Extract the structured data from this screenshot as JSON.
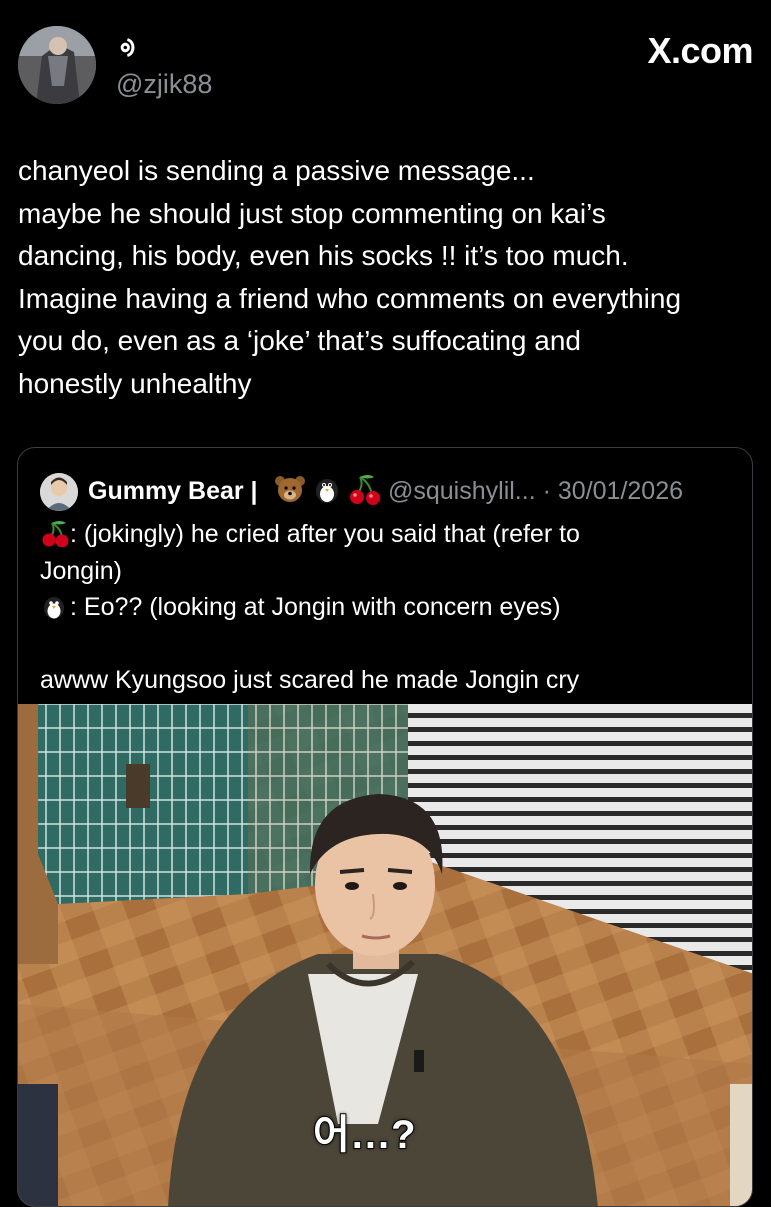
{
  "author": {
    "display_name": "ᢀ",
    "handle": "@zjik88"
  },
  "watermark": "X.com",
  "tweet_lines": [
    "chanyeol is sending a passive message...",
    "maybe he should just stop commenting on kai’s",
    "dancing, his body, even his socks !! it’s too much.",
    "Imagine having a friend who comments on everything",
    "you do, even as a ‘joke’ that’s suffocating and",
    "honestly unhealthy"
  ],
  "quote": {
    "display_name": "Gummy Bear |",
    "emoji_icons": [
      "bear-emoji-icon",
      "penguin-emoji-icon",
      "cherry-emoji-icon"
    ],
    "handle": "@squishylil...",
    "date": "30/01/2026",
    "lines": [
      ": (jokingly) he cried after you said that (refer to",
      "Jongin)",
      ": Eo?? (looking at Jongin with concern eyes)",
      "",
      "awww Kyungsoo just scared he made Jongin cry"
    ],
    "media_subtitle": "어...?"
  },
  "colors": {
    "background": "#000000",
    "text": "#ffffff",
    "muted": "#8b8f94",
    "border": "#3a3d41"
  }
}
